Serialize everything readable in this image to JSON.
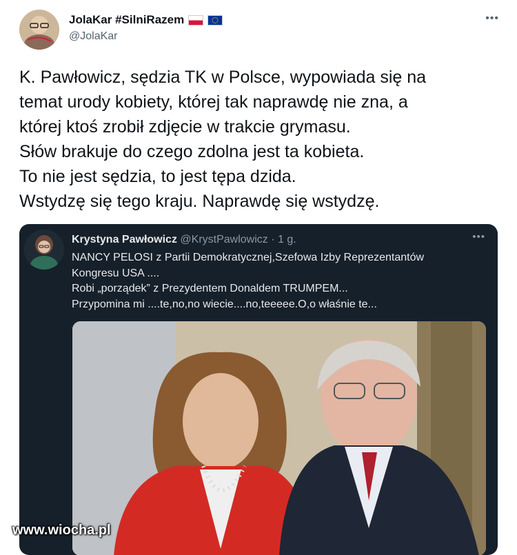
{
  "author": {
    "name": "JolaKar #SilniRazem",
    "handle": "@JolaKar",
    "flags": [
      "poland-flag",
      "eu-flag"
    ]
  },
  "more_label": "•••",
  "tweet_lines": [
    "K. Pawłowicz, sędzia TK w Polsce, wypowiada się na",
    "temat urody kobiety, której tak naprawdę nie zna, a",
    "której ktoś zrobił zdjęcie w trakcie grymasu.",
    "Słów brakuje do czego zdolna jest ta kobieta.",
    "To nie jest sędzia, to jest tępa dzida.",
    "Wstydzę się tego kraju. Naprawdę się wstydzę."
  ],
  "quote": {
    "name": "Krystyna Pawłowicz",
    "meta": "@KrystPawlowicz · 1 g.",
    "lines": [
      "NANCY PELOSI z Partii Demokratycznej,Szefowa Izby Reprezentantów",
      "Kongresu USA ....",
      "Robi „porządek” z Prezydentem Donaldem TRUMPEM...",
      "Przypomina mi ....te,no,no wiecie....no,teeeee.O,o właśnie te..."
    ]
  },
  "watermark": "www.wiocha.pl"
}
